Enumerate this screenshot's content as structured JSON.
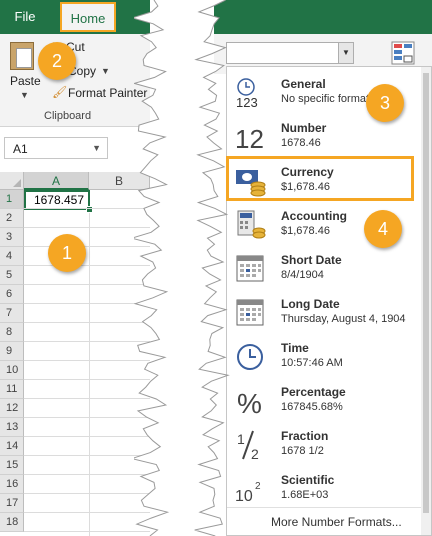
{
  "ribbon": {
    "tabs": {
      "file": "File",
      "home": "Home"
    },
    "paste_label": "Paste",
    "cut_label": "Cut",
    "copy_label": "Copy",
    "format_painter_label": "Format Painter",
    "clipboard_group_label": "Clipboard"
  },
  "namebox": {
    "value": "A1"
  },
  "grid": {
    "columns": [
      "A",
      "B"
    ],
    "rows": [
      "1",
      "2",
      "3",
      "4",
      "5",
      "6",
      "7",
      "8",
      "9",
      "10",
      "11",
      "12",
      "13",
      "14",
      "15",
      "16",
      "17",
      "18"
    ],
    "cell_a1": "1678.457"
  },
  "number_format_combo": {
    "value": ""
  },
  "number_formats": [
    {
      "name": "General",
      "example": "No specific format",
      "icon": "general-123-icon"
    },
    {
      "name": "Number",
      "example": "1678.46",
      "icon": "number-12-icon"
    },
    {
      "name": "Currency",
      "example": "$1,678.46",
      "icon": "currency-money-icon"
    },
    {
      "name": "Accounting",
      "example": " $1,678.46",
      "icon": "accounting-calculator-icon"
    },
    {
      "name": "Short Date",
      "example": "8/4/1904",
      "icon": "calendar-icon"
    },
    {
      "name": "Long Date",
      "example": "Thursday, August 4, 1904",
      "icon": "calendar-icon"
    },
    {
      "name": "Time",
      "example": "10:57:46 AM",
      "icon": "clock-icon"
    },
    {
      "name": "Percentage",
      "example": "167845.68%",
      "icon": "percent-icon"
    },
    {
      "name": "Fraction",
      "example": "1678 1/2",
      "icon": "fraction-icon"
    },
    {
      "name": "Scientific",
      "example": "1.68E+03",
      "icon": "scientific-icon"
    }
  ],
  "more_formats_label": "More Number Formats...",
  "callouts": [
    "1",
    "2",
    "3",
    "4"
  ],
  "colors": {
    "excel_green": "#217346",
    "callout_orange": "#f5a623"
  }
}
